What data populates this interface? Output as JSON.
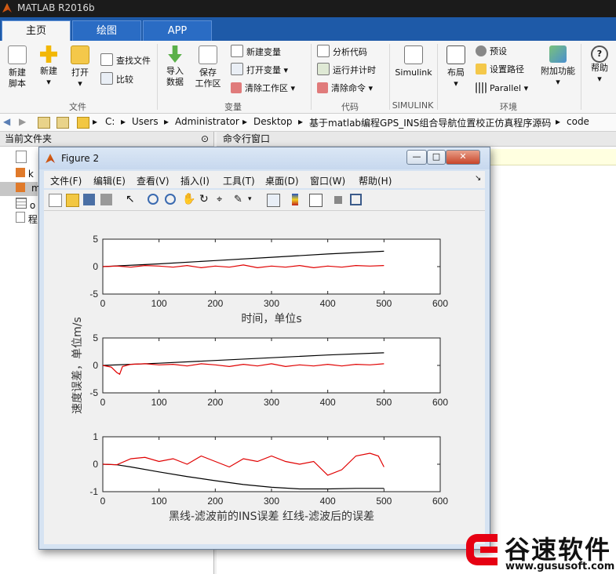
{
  "app": {
    "title": "MATLAB R2016b"
  },
  "tabs": [
    {
      "label": "主页"
    },
    {
      "label": "绘图"
    },
    {
      "label": "APP"
    }
  ],
  "ribbon": {
    "file": {
      "new_script": "新建\n脚本",
      "new": "新建",
      "open": "打开",
      "find_files": "查找文件",
      "compare": "比较",
      "group": "文件"
    },
    "variable": {
      "import": "导入\n数据",
      "save_ws": "保存\n工作区",
      "new_var": "新建变量",
      "open_var": "打开变量",
      "clear_ws": "清除工作区",
      "group": "变量"
    },
    "code": {
      "analyze": "分析代码",
      "run_time": "运行并计时",
      "clear_cmd": "清除命令",
      "group": "代码"
    },
    "simulink": {
      "label": "Simulink",
      "group": "SIMULINK"
    },
    "env": {
      "layout": "布局",
      "prefs": "预设",
      "set_path": "设置路径",
      "parallel": "Parallel",
      "addons": "附加功能",
      "group": "环境"
    },
    "help": {
      "label": "帮助"
    }
  },
  "address": {
    "parts": [
      "C:",
      "Users",
      "Administrator",
      "Desktop",
      "基于matlab编程GPS_INS组合导航位置校正仿真程序源码",
      "code"
    ]
  },
  "left_pane": {
    "title": "当前文件夹",
    "files": [
      "k",
      "m",
      "o",
      "程"
    ]
  },
  "command_window": {
    "title": "命令行窗口"
  },
  "figure": {
    "title": "Figure 2",
    "menu": [
      "文件(F)",
      "编辑(E)",
      "查看(V)",
      "插入(I)",
      "工具(T)",
      "桌面(D)",
      "窗口(W)",
      "帮助(H)"
    ],
    "window_buttons": {
      "min": "—",
      "max": "□",
      "close": "✕"
    }
  },
  "chart_data": [
    {
      "type": "line",
      "xlim": [
        0,
        600
      ],
      "ylim": [
        -5,
        5
      ],
      "xticks": [
        0,
        100,
        200,
        300,
        400,
        500,
        600
      ],
      "yticks": [
        5,
        0,
        -5
      ],
      "xlabel": "时间，单位s",
      "series": [
        {
          "color": "#000000",
          "x": [
            0,
            100,
            200,
            300,
            400,
            500
          ],
          "y": [
            0,
            0.5,
            1.1,
            1.7,
            2.3,
            2.8
          ]
        },
        {
          "color": "#e00000",
          "x": [
            0,
            25,
            50,
            75,
            100,
            125,
            150,
            175,
            200,
            225,
            250,
            275,
            300,
            325,
            350,
            375,
            400,
            425,
            450,
            475,
            500
          ],
          "y": [
            0,
            0.1,
            -0.1,
            0.2,
            0.1,
            -0.1,
            0.2,
            -0.2,
            0.1,
            -0.1,
            0.3,
            -0.2,
            0.1,
            -0.1,
            0.2,
            -0.2,
            0.1,
            -0.1,
            0.2,
            0.1,
            0.2
          ]
        }
      ]
    },
    {
      "type": "line",
      "xlim": [
        0,
        600
      ],
      "ylim": [
        -5,
        5
      ],
      "xticks": [
        0,
        100,
        200,
        300,
        400,
        500,
        600
      ],
      "yticks": [
        5,
        0,
        -5
      ],
      "ylabel": "速度误差，单位m/s",
      "series": [
        {
          "color": "#000000",
          "x": [
            0,
            100,
            200,
            300,
            400,
            500
          ],
          "y": [
            0,
            0.4,
            0.9,
            1.4,
            1.9,
            2.3
          ]
        },
        {
          "color": "#e00000",
          "x": [
            0,
            15,
            25,
            30,
            35,
            50,
            75,
            100,
            125,
            150,
            175,
            200,
            225,
            250,
            275,
            300,
            325,
            350,
            375,
            400,
            425,
            450,
            475,
            500
          ],
          "y": [
            0,
            -0.3,
            -1.3,
            -1.6,
            -0.2,
            0.2,
            0.3,
            0.1,
            0.2,
            -0.1,
            0.3,
            0.1,
            -0.2,
            0.2,
            -0.1,
            0.3,
            -0.2,
            0.1,
            -0.1,
            0.2,
            -0.1,
            0.2,
            0.1,
            0.3
          ]
        }
      ]
    },
    {
      "type": "line",
      "xlim": [
        0,
        600
      ],
      "ylim": [
        -1,
        1
      ],
      "xticks": [
        0,
        100,
        200,
        300,
        400,
        500,
        600
      ],
      "yticks": [
        1,
        0,
        -1
      ],
      "xlabel": "黑线-滤波前的INS误差   红线-滤波后的误差",
      "series": [
        {
          "color": "#000000",
          "x": [
            0,
            25,
            50,
            100,
            150,
            200,
            250,
            300,
            350,
            400,
            450,
            500
          ],
          "y": [
            0,
            -0.02,
            -0.1,
            -0.28,
            -0.45,
            -0.6,
            -0.74,
            -0.84,
            -0.9,
            -0.9,
            -0.88,
            -0.88
          ]
        },
        {
          "color": "#e00000",
          "x": [
            0,
            25,
            50,
            75,
            100,
            125,
            150,
            175,
            200,
            225,
            250,
            275,
            300,
            325,
            350,
            375,
            400,
            425,
            450,
            475,
            490,
            500
          ],
          "y": [
            0,
            -0.02,
            0.2,
            0.25,
            0.1,
            0.2,
            0.0,
            0.3,
            0.1,
            -0.1,
            0.2,
            0.1,
            0.3,
            0.1,
            0.0,
            0.1,
            -0.4,
            -0.2,
            0.3,
            0.4,
            0.3,
            -0.1
          ]
        }
      ]
    }
  ],
  "watermark": {
    "text": "谷速软件",
    "url": "www.gususoft.com"
  }
}
